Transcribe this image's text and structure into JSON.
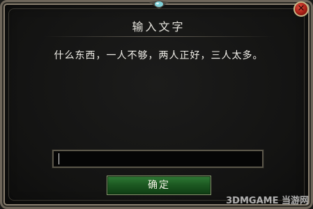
{
  "dialog": {
    "title": "输入文字",
    "message": "什么东西，一人不够，两人正好，三人太多。",
    "input": {
      "value": "",
      "placeholder": ""
    },
    "confirm_label": "确定",
    "close_icon": "close-icon",
    "close_glyph": "✕"
  },
  "watermark": {
    "text": "3DMGAME 当游网"
  },
  "colors": {
    "frame_border": "#6e665a",
    "confirm_button_bg": "#1d5a22",
    "close_button_bg": "#a51d14",
    "text": "#e8e6df"
  }
}
